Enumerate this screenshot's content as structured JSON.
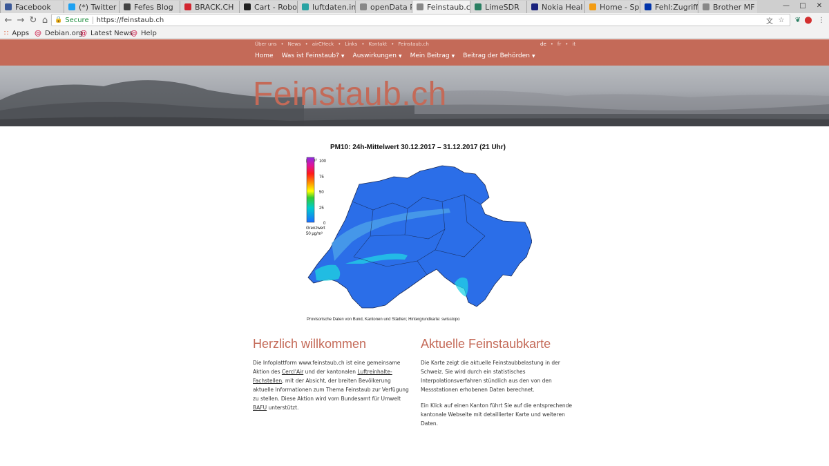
{
  "browser": {
    "tabs": [
      {
        "label": "Facebook",
        "icon": "facebook-icon",
        "color": "#3b5998"
      },
      {
        "label": "(*) Twitter",
        "icon": "twitter-icon",
        "color": "#1da1f2"
      },
      {
        "label": "Fefes Blog",
        "icon": "fefe-icon",
        "color": "#444444"
      },
      {
        "label": "BRACK.CH",
        "icon": "brack-icon",
        "color": "#d22630"
      },
      {
        "label": "Cart - Robo",
        "icon": "cart-icon",
        "color": "#222222"
      },
      {
        "label": "luftdaten.in",
        "icon": "luftdaten-icon",
        "color": "#29a3a3"
      },
      {
        "label": "openData P",
        "icon": "page-icon",
        "color": "#888888"
      },
      {
        "label": "Feinstaub.c",
        "icon": "page-icon",
        "color": "#888888"
      },
      {
        "label": "LimeSDR",
        "icon": "limesdr-icon",
        "color": "#2a7f62"
      },
      {
        "label": "Nokia Heal",
        "icon": "nokia-icon",
        "color": "#1a237e"
      },
      {
        "label": "Home - Sp",
        "icon": "home-icon",
        "color": "#f39c12"
      },
      {
        "label": "Fehl:Zugriff",
        "icon": "error-icon",
        "color": "#0033aa"
      },
      {
        "label": "Brother MF",
        "icon": "page-icon",
        "color": "#888888"
      }
    ],
    "active_tab": 7,
    "secure_label": "Secure",
    "url": "https://feinstaub.ch",
    "bookmarks": [
      {
        "label": "Apps",
        "icon": "apps-grid-icon"
      },
      {
        "label": "Debian.org",
        "icon": "debian-swirl-icon"
      },
      {
        "label": "Latest News",
        "icon": "debian-swirl-icon"
      },
      {
        "label": "Help",
        "icon": "debian-swirl-icon"
      }
    ]
  },
  "site": {
    "top_links": [
      "Über uns",
      "News",
      "airCHeck",
      "Links",
      "Kontakt",
      "Feinstaub.ch"
    ],
    "languages": [
      "de",
      "fr",
      "it"
    ],
    "menu": [
      "Home",
      "Was ist Feinstaub?",
      "Auswirkungen",
      "Mein Beitrag",
      "Beitrag der Behörden"
    ],
    "brand": "Feinstaub.ch",
    "accent": "#c46a58"
  },
  "map": {
    "title": "PM10: 24h-Mittelwert 30.12.2017 – 31.12.2017 (21 Uhr)",
    "unit": "µg/m³",
    "scale_labels": [
      "100",
      "75",
      "50",
      "25",
      "0"
    ],
    "limit_label": "Grenzwert",
    "limit_value": "50 µg/m³",
    "caption": "Provisorische Daten von Bund, Kantonen und Städten; Hintergrundkarte: swisstopo"
  },
  "welcome": {
    "title": "Herzlich willkommen",
    "p1_a": "Die Infoplattform www.feinstaub.ch ist eine gemeinsame Aktion des ",
    "p1_link1": "Cercl'Air",
    "p1_b": " und der kantonalen ",
    "p1_link2": "Luftreinhalte-Fachstellen",
    "p1_c": ", mit der Absicht, der breiten Bevölkerung aktuelle Informationen zum Thema Feinstaub zur Verfügung zu stellen. Diese Aktion wird vom Bundesamt für Umwelt ",
    "p1_link3": "BAFU",
    "p1_d": " unterstützt."
  },
  "current_map": {
    "title": "Aktuelle Feinstaubkarte",
    "p1": "Die Karte zeigt die aktuelle Feinstaubbelastung in der Schweiz. Sie wird durch ein statistisches Interpolationsverfahren stündlich aus den von den Messstationen erhobenen Daten berechnet.",
    "p2": "Ein Klick auf einen Kanton führt Sie auf die entsprechende kantonale Webseite mit detaillierter Karte und weiteren Daten."
  }
}
